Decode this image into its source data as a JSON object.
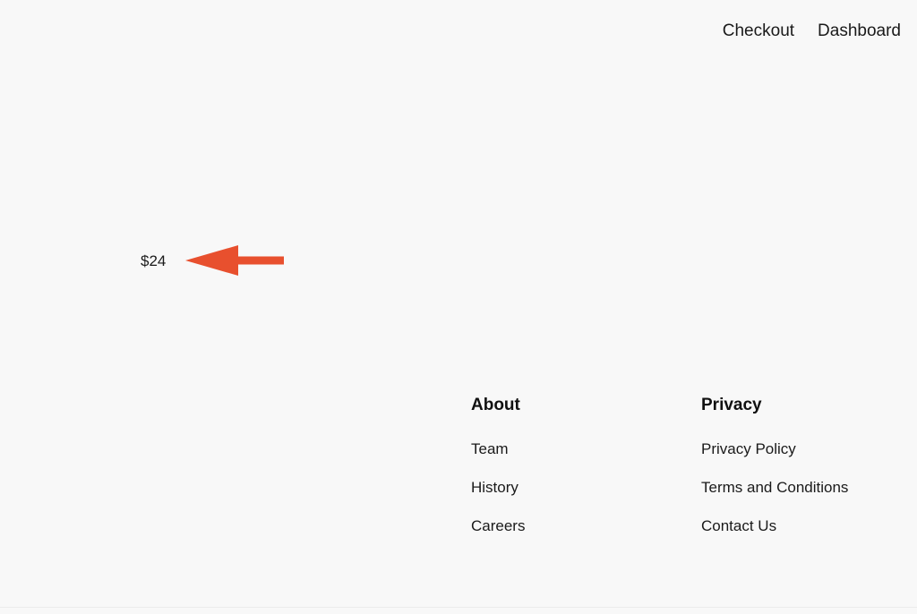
{
  "page": {
    "background_color": "#f8f8f8",
    "text_color": "#1a1a1a"
  },
  "topnav": {
    "links": [
      {
        "label": "Checkout",
        "name": "nav-link-checkout"
      },
      {
        "label": "Dashboard",
        "name": "nav-link-dashboard"
      }
    ]
  },
  "product": {
    "price": "$24"
  },
  "annotation": {
    "type": "arrow",
    "direction": "left",
    "color": "#e8502e",
    "points_at": "$24",
    "label": "price-annotation-arrow"
  },
  "footer": {
    "columns": [
      {
        "heading": "About",
        "links": [
          {
            "label": "Team"
          },
          {
            "label": "History"
          },
          {
            "label": "Careers"
          }
        ]
      },
      {
        "heading": "Privacy",
        "links": [
          {
            "label": "Privacy Policy"
          },
          {
            "label": "Terms and Conditions"
          },
          {
            "label": "Contact Us"
          }
        ]
      }
    ]
  }
}
